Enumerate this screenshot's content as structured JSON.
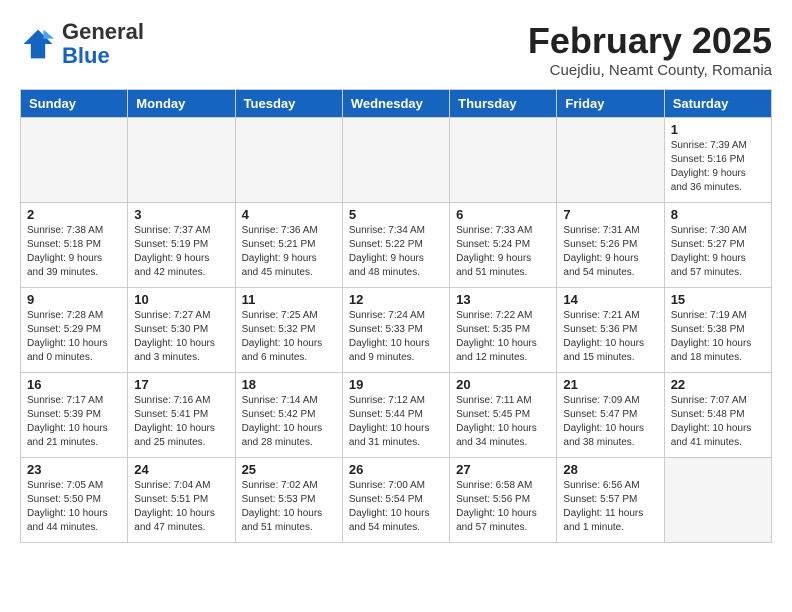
{
  "logo": {
    "general": "General",
    "blue": "Blue"
  },
  "header": {
    "month": "February 2025",
    "location": "Cuejdiu, Neamt County, Romania"
  },
  "weekdays": [
    "Sunday",
    "Monday",
    "Tuesday",
    "Wednesday",
    "Thursday",
    "Friday",
    "Saturday"
  ],
  "weeks": [
    [
      {
        "day": null
      },
      {
        "day": null
      },
      {
        "day": null
      },
      {
        "day": null
      },
      {
        "day": null
      },
      {
        "day": null
      },
      {
        "day": 1,
        "info": "Sunrise: 7:39 AM\nSunset: 5:16 PM\nDaylight: 9 hours and 36 minutes."
      }
    ],
    [
      {
        "day": 2,
        "info": "Sunrise: 7:38 AM\nSunset: 5:18 PM\nDaylight: 9 hours and 39 minutes."
      },
      {
        "day": 3,
        "info": "Sunrise: 7:37 AM\nSunset: 5:19 PM\nDaylight: 9 hours and 42 minutes."
      },
      {
        "day": 4,
        "info": "Sunrise: 7:36 AM\nSunset: 5:21 PM\nDaylight: 9 hours and 45 minutes."
      },
      {
        "day": 5,
        "info": "Sunrise: 7:34 AM\nSunset: 5:22 PM\nDaylight: 9 hours and 48 minutes."
      },
      {
        "day": 6,
        "info": "Sunrise: 7:33 AM\nSunset: 5:24 PM\nDaylight: 9 hours and 51 minutes."
      },
      {
        "day": 7,
        "info": "Sunrise: 7:31 AM\nSunset: 5:26 PM\nDaylight: 9 hours and 54 minutes."
      },
      {
        "day": 8,
        "info": "Sunrise: 7:30 AM\nSunset: 5:27 PM\nDaylight: 9 hours and 57 minutes."
      }
    ],
    [
      {
        "day": 9,
        "info": "Sunrise: 7:28 AM\nSunset: 5:29 PM\nDaylight: 10 hours and 0 minutes."
      },
      {
        "day": 10,
        "info": "Sunrise: 7:27 AM\nSunset: 5:30 PM\nDaylight: 10 hours and 3 minutes."
      },
      {
        "day": 11,
        "info": "Sunrise: 7:25 AM\nSunset: 5:32 PM\nDaylight: 10 hours and 6 minutes."
      },
      {
        "day": 12,
        "info": "Sunrise: 7:24 AM\nSunset: 5:33 PM\nDaylight: 10 hours and 9 minutes."
      },
      {
        "day": 13,
        "info": "Sunrise: 7:22 AM\nSunset: 5:35 PM\nDaylight: 10 hours and 12 minutes."
      },
      {
        "day": 14,
        "info": "Sunrise: 7:21 AM\nSunset: 5:36 PM\nDaylight: 10 hours and 15 minutes."
      },
      {
        "day": 15,
        "info": "Sunrise: 7:19 AM\nSunset: 5:38 PM\nDaylight: 10 hours and 18 minutes."
      }
    ],
    [
      {
        "day": 16,
        "info": "Sunrise: 7:17 AM\nSunset: 5:39 PM\nDaylight: 10 hours and 21 minutes."
      },
      {
        "day": 17,
        "info": "Sunrise: 7:16 AM\nSunset: 5:41 PM\nDaylight: 10 hours and 25 minutes."
      },
      {
        "day": 18,
        "info": "Sunrise: 7:14 AM\nSunset: 5:42 PM\nDaylight: 10 hours and 28 minutes."
      },
      {
        "day": 19,
        "info": "Sunrise: 7:12 AM\nSunset: 5:44 PM\nDaylight: 10 hours and 31 minutes."
      },
      {
        "day": 20,
        "info": "Sunrise: 7:11 AM\nSunset: 5:45 PM\nDaylight: 10 hours and 34 minutes."
      },
      {
        "day": 21,
        "info": "Sunrise: 7:09 AM\nSunset: 5:47 PM\nDaylight: 10 hours and 38 minutes."
      },
      {
        "day": 22,
        "info": "Sunrise: 7:07 AM\nSunset: 5:48 PM\nDaylight: 10 hours and 41 minutes."
      }
    ],
    [
      {
        "day": 23,
        "info": "Sunrise: 7:05 AM\nSunset: 5:50 PM\nDaylight: 10 hours and 44 minutes."
      },
      {
        "day": 24,
        "info": "Sunrise: 7:04 AM\nSunset: 5:51 PM\nDaylight: 10 hours and 47 minutes."
      },
      {
        "day": 25,
        "info": "Sunrise: 7:02 AM\nSunset: 5:53 PM\nDaylight: 10 hours and 51 minutes."
      },
      {
        "day": 26,
        "info": "Sunrise: 7:00 AM\nSunset: 5:54 PM\nDaylight: 10 hours and 54 minutes."
      },
      {
        "day": 27,
        "info": "Sunrise: 6:58 AM\nSunset: 5:56 PM\nDaylight: 10 hours and 57 minutes."
      },
      {
        "day": 28,
        "info": "Sunrise: 6:56 AM\nSunset: 5:57 PM\nDaylight: 11 hours and 1 minute."
      },
      {
        "day": null
      }
    ]
  ]
}
